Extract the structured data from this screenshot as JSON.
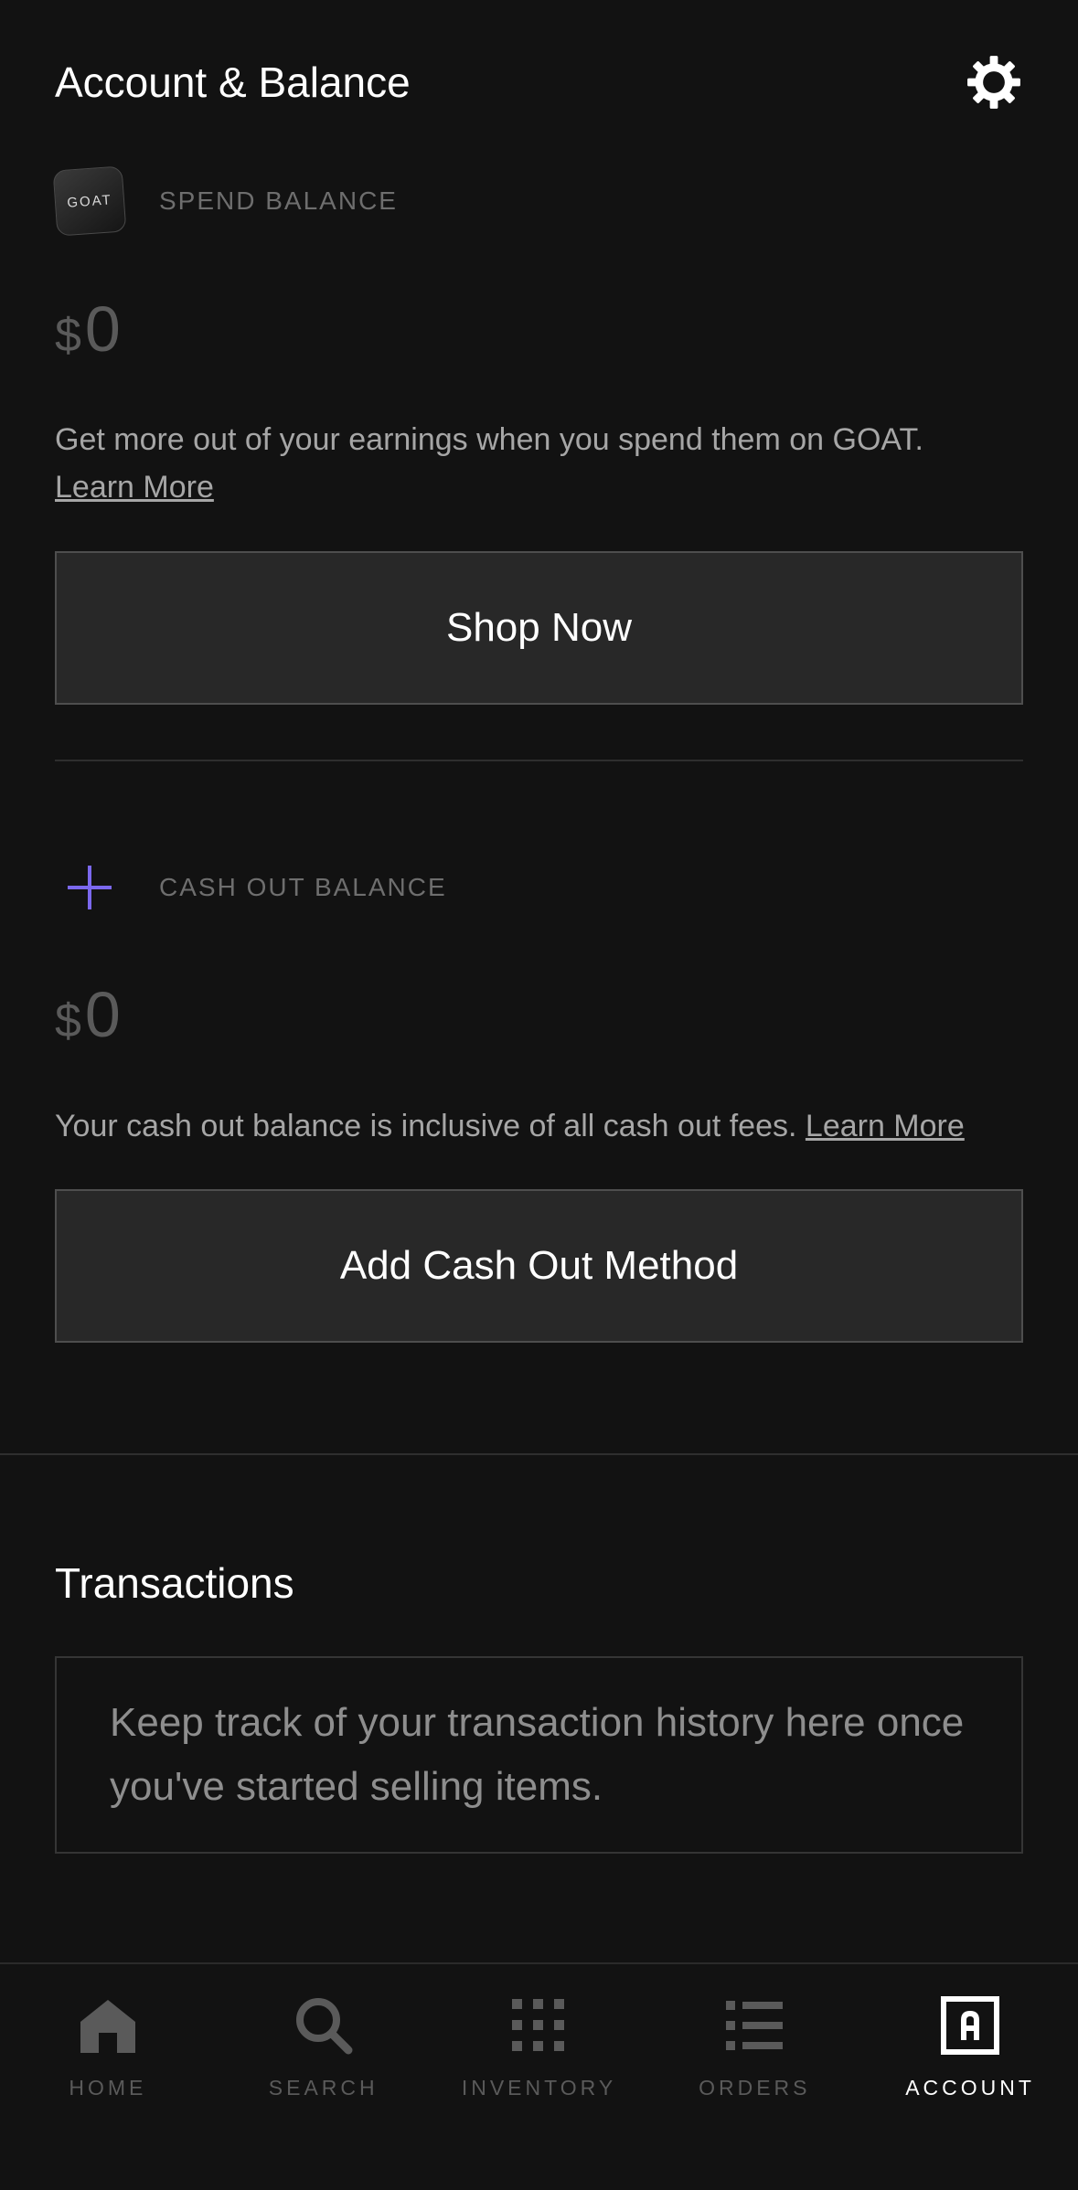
{
  "header": {
    "title": "Account & Balance"
  },
  "spend": {
    "badge_text": "GOAT",
    "label": "SPEND BALANCE",
    "currency": "$",
    "amount": "0",
    "description": "Get more out of your earnings when you spend them on GOAT.",
    "learn_more": "Learn More",
    "button": "Shop Now"
  },
  "cashout": {
    "label": "CASH OUT BALANCE",
    "currency": "$",
    "amount": "0",
    "description": "Your cash out balance is inclusive of all cash out fees.",
    "learn_more": "Learn More",
    "button": "Add Cash Out Method"
  },
  "transactions": {
    "title": "Transactions",
    "empty_message": "Keep track of your transaction history here once you've started selling items."
  },
  "tabs": [
    {
      "label": "HOME",
      "icon": "home-icon"
    },
    {
      "label": "SEARCH",
      "icon": "search-icon"
    },
    {
      "label": "INVENTORY",
      "icon": "inventory-grid-icon"
    },
    {
      "label": "ORDERS",
      "icon": "orders-list-icon"
    },
    {
      "label": "ACCOUNT",
      "icon": "account-icon",
      "active": true
    }
  ],
  "colors": {
    "accent_purple": "#7b68ee",
    "background": "#121212"
  }
}
